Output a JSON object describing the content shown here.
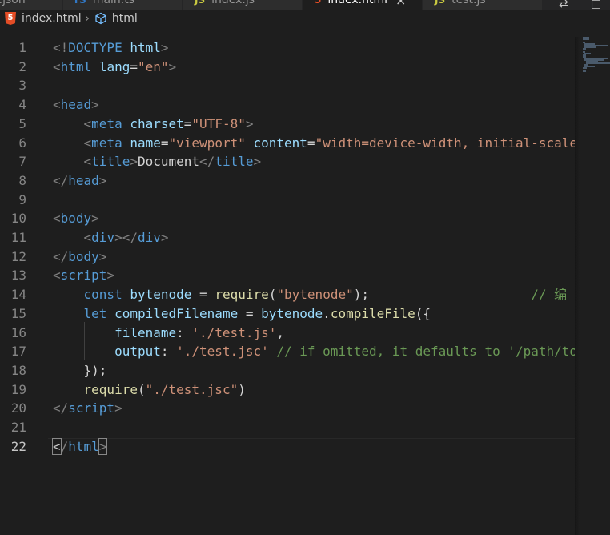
{
  "tabs": [
    {
      "label": "e.json",
      "icon": "json-icon",
      "active": false
    },
    {
      "label": "main.ts",
      "icon": "typescript-icon",
      "active": false
    },
    {
      "label": "index.js",
      "icon": "javascript-icon",
      "active": false
    },
    {
      "label": "index.html",
      "icon": "html-icon",
      "active": true
    },
    {
      "label": "test.js",
      "icon": "javascript-icon",
      "active": false
    }
  ],
  "breadcrumb": {
    "file": "index.html",
    "symbol": "html"
  },
  "editor": {
    "language": "html",
    "current_line": 22,
    "lines": [
      {
        "n": "1",
        "indent": "",
        "tokens": [
          [
            "punc",
            "<!"
          ],
          [
            "tag",
            "DOCTYPE"
          ],
          [
            "text",
            " "
          ],
          [
            "attr",
            "html"
          ],
          [
            "punc",
            ">"
          ]
        ]
      },
      {
        "n": "2",
        "indent": "",
        "tokens": [
          [
            "punc",
            "<"
          ],
          [
            "tag",
            "html"
          ],
          [
            "text",
            " "
          ],
          [
            "attr",
            "lang"
          ],
          [
            "text",
            "="
          ],
          [
            "str",
            "\"en\""
          ],
          [
            "punc",
            ">"
          ]
        ]
      },
      {
        "n": "3",
        "indent": "",
        "tokens": []
      },
      {
        "n": "4",
        "indent": "",
        "tokens": [
          [
            "punc",
            "<"
          ],
          [
            "tag",
            "head"
          ],
          [
            "punc",
            ">"
          ]
        ]
      },
      {
        "n": "5",
        "indent": "    ",
        "tokens": [
          [
            "punc",
            "<"
          ],
          [
            "tag",
            "meta"
          ],
          [
            "text",
            " "
          ],
          [
            "attr",
            "charset"
          ],
          [
            "text",
            "="
          ],
          [
            "str",
            "\"UTF-8\""
          ],
          [
            "punc",
            ">"
          ]
        ]
      },
      {
        "n": "6",
        "indent": "    ",
        "tokens": [
          [
            "punc",
            "<"
          ],
          [
            "tag",
            "meta"
          ],
          [
            "text",
            " "
          ],
          [
            "attr",
            "name"
          ],
          [
            "text",
            "="
          ],
          [
            "str",
            "\"viewport\""
          ],
          [
            "text",
            " "
          ],
          [
            "attr",
            "content"
          ],
          [
            "text",
            "="
          ],
          [
            "str",
            "\"width=device-width, initial-scale"
          ]
        ]
      },
      {
        "n": "7",
        "indent": "    ",
        "tokens": [
          [
            "punc",
            "<"
          ],
          [
            "tag",
            "title"
          ],
          [
            "punc",
            ">"
          ],
          [
            "text",
            "Document"
          ],
          [
            "punc",
            "</"
          ],
          [
            "tag",
            "title"
          ],
          [
            "punc",
            ">"
          ]
        ]
      },
      {
        "n": "8",
        "indent": "",
        "tokens": [
          [
            "punc",
            "</"
          ],
          [
            "tag",
            "head"
          ],
          [
            "punc",
            ">"
          ]
        ]
      },
      {
        "n": "9",
        "indent": "",
        "tokens": []
      },
      {
        "n": "10",
        "indent": "",
        "tokens": [
          [
            "punc",
            "<"
          ],
          [
            "tag",
            "body"
          ],
          [
            "punc",
            ">"
          ]
        ]
      },
      {
        "n": "11",
        "indent": "    ",
        "tokens": [
          [
            "punc",
            "<"
          ],
          [
            "tag",
            "div"
          ],
          [
            "punc",
            "></"
          ],
          [
            "tag",
            "div"
          ],
          [
            "punc",
            ">"
          ]
        ]
      },
      {
        "n": "12",
        "indent": "",
        "tokens": [
          [
            "punc",
            "</"
          ],
          [
            "tag",
            "body"
          ],
          [
            "punc",
            ">"
          ]
        ]
      },
      {
        "n": "13",
        "indent": "",
        "tokens": [
          [
            "punc",
            "<"
          ],
          [
            "tag",
            "script"
          ],
          [
            "punc",
            ">"
          ]
        ]
      },
      {
        "n": "14",
        "indent": "    ",
        "tokens": [
          [
            "kw",
            "const"
          ],
          [
            "text",
            " "
          ],
          [
            "var",
            "bytenode"
          ],
          [
            "text",
            " = "
          ],
          [
            "fn",
            "require"
          ],
          [
            "text",
            "("
          ],
          [
            "str",
            "\"bytenode\""
          ],
          [
            "text",
            ");"
          ],
          [
            "text",
            "                     "
          ],
          [
            "com",
            "// 编"
          ]
        ]
      },
      {
        "n": "15",
        "indent": "    ",
        "tokens": [
          [
            "kw",
            "let"
          ],
          [
            "text",
            " "
          ],
          [
            "var",
            "compiledFilename"
          ],
          [
            "text",
            " = "
          ],
          [
            "var",
            "bytenode"
          ],
          [
            "text",
            "."
          ],
          [
            "fn",
            "compileFile"
          ],
          [
            "text",
            "({"
          ]
        ]
      },
      {
        "n": "16",
        "indent": "        ",
        "tokens": [
          [
            "var",
            "filename"
          ],
          [
            "text",
            ": "
          ],
          [
            "str",
            "'./test.js'"
          ],
          [
            "text",
            ","
          ]
        ]
      },
      {
        "n": "17",
        "indent": "        ",
        "tokens": [
          [
            "var",
            "output"
          ],
          [
            "text",
            ": "
          ],
          [
            "str",
            "'./test.jsc'"
          ],
          [
            "text",
            " "
          ],
          [
            "com",
            "// if omitted, it defaults to '/path/to"
          ]
        ]
      },
      {
        "n": "18",
        "indent": "    ",
        "tokens": [
          [
            "text",
            "});"
          ]
        ]
      },
      {
        "n": "19",
        "indent": "    ",
        "tokens": [
          [
            "fn",
            "require"
          ],
          [
            "text",
            "("
          ],
          [
            "str",
            "\"./test.jsc\""
          ],
          [
            "text",
            ")"
          ]
        ]
      },
      {
        "n": "20",
        "indent": "",
        "tokens": [
          [
            "punc",
            "</"
          ],
          [
            "tag",
            "script"
          ],
          [
            "punc",
            ">"
          ]
        ]
      },
      {
        "n": "21",
        "indent": "",
        "tokens": []
      },
      {
        "n": "22",
        "indent": "",
        "tokens": [
          [
            "punc",
            "</"
          ],
          [
            "tag",
            "html"
          ],
          [
            "punc",
            ">"
          ]
        ]
      }
    ]
  },
  "colors": {
    "editor_bg": "#1e1e1e",
    "tag": "#569cd6",
    "attr": "#9cdcfe",
    "string": "#ce9178",
    "function": "#dcdcaa",
    "comment": "#6a9955"
  }
}
